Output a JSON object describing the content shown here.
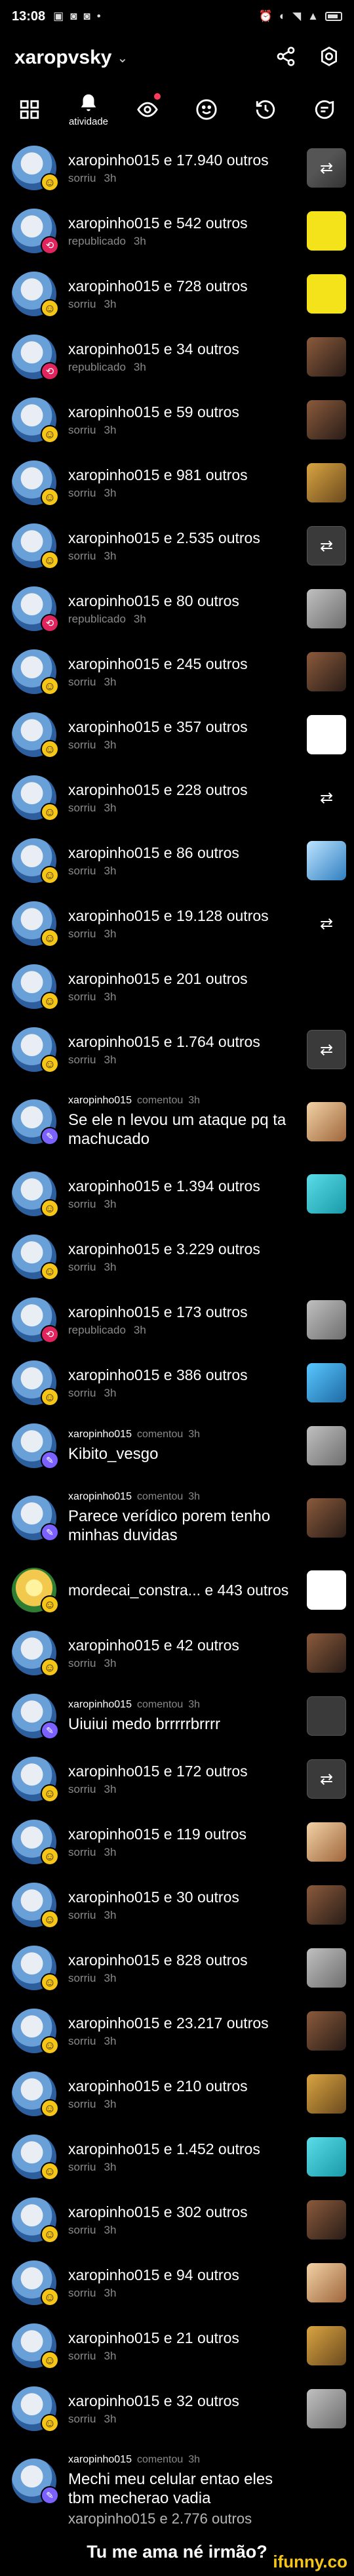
{
  "status_bar": {
    "time": "13:08"
  },
  "app_bar": {
    "title": "xaropvsky"
  },
  "tabs": {
    "active_label": "atividade"
  },
  "activity": [
    {
      "type": "action",
      "user": "xaropinho015",
      "others": "e 17.940 outros",
      "action": "sorriu",
      "time": "3h",
      "badge": "smile",
      "thumb": "th-a",
      "thumb_glyph": "⇄"
    },
    {
      "type": "action",
      "user": "xaropinho015",
      "others": "e 542 outros",
      "action": "republicado",
      "time": "3h",
      "badge": "repost",
      "thumb": "th-b",
      "thumb_glyph": ""
    },
    {
      "type": "action",
      "user": "xaropinho015",
      "others": "e 728 outros",
      "action": "sorriu",
      "time": "3h",
      "badge": "smile",
      "thumb": "th-b",
      "thumb_glyph": ""
    },
    {
      "type": "action",
      "user": "xaropinho015",
      "others": "e 34 outros",
      "action": "republicado",
      "time": "3h",
      "badge": "repost",
      "thumb": "th-c",
      "thumb_glyph": ""
    },
    {
      "type": "action",
      "user": "xaropinho015",
      "others": "e 59 outros",
      "action": "sorriu",
      "time": "3h",
      "badge": "smile",
      "thumb": "th-c",
      "thumb_glyph": ""
    },
    {
      "type": "action",
      "user": "xaropinho015",
      "others": "e 981 outros",
      "action": "sorriu",
      "time": "3h",
      "badge": "smile",
      "thumb": "th-d",
      "thumb_glyph": ""
    },
    {
      "type": "action",
      "user": "xaropinho015",
      "others": "e 2.535 outros",
      "action": "sorriu",
      "time": "3h",
      "badge": "smile",
      "thumb": "th-e",
      "thumb_glyph": "⇄"
    },
    {
      "type": "action",
      "user": "xaropinho015",
      "others": "e 80 outros",
      "action": "republicado",
      "time": "3h",
      "badge": "repost",
      "thumb": "th-f",
      "thumb_glyph": ""
    },
    {
      "type": "action",
      "user": "xaropinho015",
      "others": "e 245 outros",
      "action": "sorriu",
      "time": "3h",
      "badge": "smile",
      "thumb": "th-c",
      "thumb_glyph": ""
    },
    {
      "type": "action",
      "user": "xaropinho015",
      "others": "e 357 outros",
      "action": "sorriu",
      "time": "3h",
      "badge": "smile",
      "thumb": "th-i",
      "thumb_glyph": ""
    },
    {
      "type": "action",
      "user": "xaropinho015",
      "others": "e 228 outros",
      "action": "sorriu",
      "time": "3h",
      "badge": "smile",
      "thumb": "th-k",
      "thumb_glyph": "⇄"
    },
    {
      "type": "action",
      "user": "xaropinho015",
      "others": "e 86 outros",
      "action": "sorriu",
      "time": "3h",
      "badge": "smile",
      "thumb": "th-g",
      "thumb_glyph": ""
    },
    {
      "type": "action",
      "user": "xaropinho015",
      "others": "e 19.128 outros",
      "action": "sorriu",
      "time": "3h",
      "badge": "smile",
      "thumb": "th-k",
      "thumb_glyph": "⇄"
    },
    {
      "type": "action",
      "user": "xaropinho015",
      "others": "e 201 outros",
      "action": "sorriu",
      "time": "3h",
      "badge": "smile",
      "thumb": "th-k",
      "thumb_glyph": ""
    },
    {
      "type": "action",
      "user": "xaropinho015",
      "others": "e 1.764 outros",
      "action": "sorriu",
      "time": "3h",
      "badge": "smile",
      "thumb": "th-e",
      "thumb_glyph": "⇄"
    },
    {
      "type": "comment",
      "user": "xaropinho015",
      "meta": "comentou",
      "time": "3h",
      "text": "Se ele n levou um ataque pq ta machucado",
      "thumb": "th-h",
      "thumb_glyph": ""
    },
    {
      "type": "action",
      "user": "xaropinho015",
      "others": "e 1.394 outros",
      "action": "sorriu",
      "time": "3h",
      "badge": "smile",
      "thumb": "th-l",
      "thumb_glyph": ""
    },
    {
      "type": "action",
      "user": "xaropinho015",
      "others": "e 3.229 outros",
      "action": "sorriu",
      "time": "3h",
      "badge": "smile",
      "thumb": "th-k",
      "thumb_glyph": ""
    },
    {
      "type": "action",
      "user": "xaropinho015",
      "others": "e 173 outros",
      "action": "republicado",
      "time": "3h",
      "badge": "repost",
      "thumb": "th-f",
      "thumb_glyph": ""
    },
    {
      "type": "action",
      "user": "xaropinho015",
      "others": "e 386 outros",
      "action": "sorriu",
      "time": "3h",
      "badge": "smile",
      "thumb": "th-j",
      "thumb_glyph": ""
    },
    {
      "type": "comment",
      "user": "xaropinho015",
      "meta": "comentou",
      "time": "3h",
      "text": "Kibito_vesgo",
      "thumb": "th-f",
      "thumb_glyph": ""
    },
    {
      "type": "comment",
      "user": "xaropinho015",
      "meta": "comentou",
      "time": "3h",
      "text": "Parece verídico porem tenho minhas duvidas",
      "thumb": "th-c",
      "thumb_glyph": ""
    },
    {
      "type": "action",
      "user": "mordecai_constra...",
      "others": "e 443 outros",
      "action": "",
      "time": "",
      "badge": "smile",
      "thumb": "th-i",
      "thumb_glyph": "",
      "alt": true
    },
    {
      "type": "action",
      "user": "xaropinho015",
      "others": "e 42 outros",
      "action": "sorriu",
      "time": "3h",
      "badge": "smile",
      "thumb": "th-c",
      "thumb_glyph": ""
    },
    {
      "type": "comment",
      "user": "xaropinho015",
      "meta": "comentou",
      "time": "3h",
      "text": "Uiuiui medo brrrrrbrrrr",
      "thumb": "th-e",
      "thumb_glyph": ""
    },
    {
      "type": "action",
      "user": "xaropinho015",
      "others": "e 172 outros",
      "action": "sorriu",
      "time": "3h",
      "badge": "smile",
      "thumb": "th-e",
      "thumb_glyph": "⇄"
    },
    {
      "type": "action",
      "user": "xaropinho015",
      "others": "e 119 outros",
      "action": "sorriu",
      "time": "3h",
      "badge": "smile",
      "thumb": "th-h",
      "thumb_glyph": ""
    },
    {
      "type": "action",
      "user": "xaropinho015",
      "others": "e 30 outros",
      "action": "sorriu",
      "time": "3h",
      "badge": "smile",
      "thumb": "th-c",
      "thumb_glyph": ""
    },
    {
      "type": "action",
      "user": "xaropinho015",
      "others": "e 828 outros",
      "action": "sorriu",
      "time": "3h",
      "badge": "smile",
      "thumb": "th-f",
      "thumb_glyph": ""
    },
    {
      "type": "action",
      "user": "xaropinho015",
      "others": "e 23.217 outros",
      "action": "sorriu",
      "time": "3h",
      "badge": "smile",
      "thumb": "th-c",
      "thumb_glyph": ""
    },
    {
      "type": "action",
      "user": "xaropinho015",
      "others": "e 210 outros",
      "action": "sorriu",
      "time": "3h",
      "badge": "smile",
      "thumb": "th-d",
      "thumb_glyph": ""
    },
    {
      "type": "action",
      "user": "xaropinho015",
      "others": "e 1.452 outros",
      "action": "sorriu",
      "time": "3h",
      "badge": "smile",
      "thumb": "th-l",
      "thumb_glyph": ""
    },
    {
      "type": "action",
      "user": "xaropinho015",
      "others": "e 302 outros",
      "action": "sorriu",
      "time": "3h",
      "badge": "smile",
      "thumb": "th-c",
      "thumb_glyph": ""
    },
    {
      "type": "action",
      "user": "xaropinho015",
      "others": "e 94 outros",
      "action": "sorriu",
      "time": "3h",
      "badge": "smile",
      "thumb": "th-h",
      "thumb_glyph": ""
    },
    {
      "type": "action",
      "user": "xaropinho015",
      "others": "e 21 outros",
      "action": "sorriu",
      "time": "3h",
      "badge": "smile",
      "thumb": "th-d",
      "thumb_glyph": ""
    },
    {
      "type": "action",
      "user": "xaropinho015",
      "others": "e 32 outros",
      "action": "sorriu",
      "time": "3h",
      "badge": "smile",
      "thumb": "th-f",
      "thumb_glyph": ""
    },
    {
      "type": "comment",
      "user": "xaropinho015",
      "meta": "comentou",
      "time": "3h",
      "text": "Mechi meu celular entao eles tbm mecherao vadia",
      "thumb": "th-k",
      "thumb_glyph": ""
    }
  ],
  "footer": {
    "partial_row": "xaropinho015 e 2.776 outros",
    "caption": "Tu me ama né irmão?",
    "brand": "ifunny.co"
  },
  "colors": {
    "background": "#000000",
    "secondary_text": "#8a8a8a",
    "brand": "#f5c518",
    "notification_dot": "#ff3b5c"
  }
}
